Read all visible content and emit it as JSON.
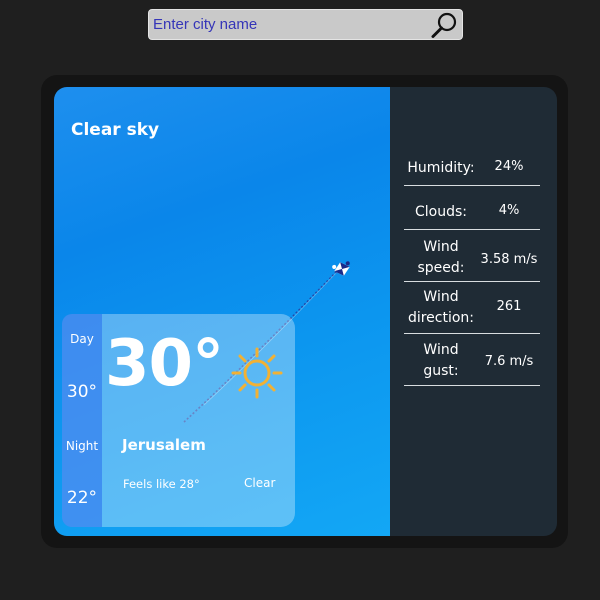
{
  "search": {
    "placeholder": "Enter city name",
    "button_icon": "search-icon"
  },
  "weather": {
    "condition": "Clear sky",
    "temperature": "30°",
    "icon": "sun-icon",
    "city": "Jerusalem",
    "feels_like": "Feels like 28°",
    "status_short": "Clear"
  },
  "forecast": {
    "day_label": "Day",
    "day_temp": "30°",
    "night_label": "Night",
    "night_temp": "22°"
  },
  "details": [
    {
      "label": "Humidity:",
      "value": "24%"
    },
    {
      "label": "Clouds:",
      "value": "4%"
    },
    {
      "label": "Wind speed:",
      "value": "3.58 m/s"
    },
    {
      "label": "Wind direction:",
      "value": "261"
    },
    {
      "label": "Wind gust:",
      "value": "7.6 m/s"
    }
  ],
  "colors": {
    "background": "#1f1f1f",
    "sky": "#0a86ea",
    "details_panel": "#1f2b35",
    "sun": "#f2b134",
    "search_text": "#2a2aa5"
  }
}
